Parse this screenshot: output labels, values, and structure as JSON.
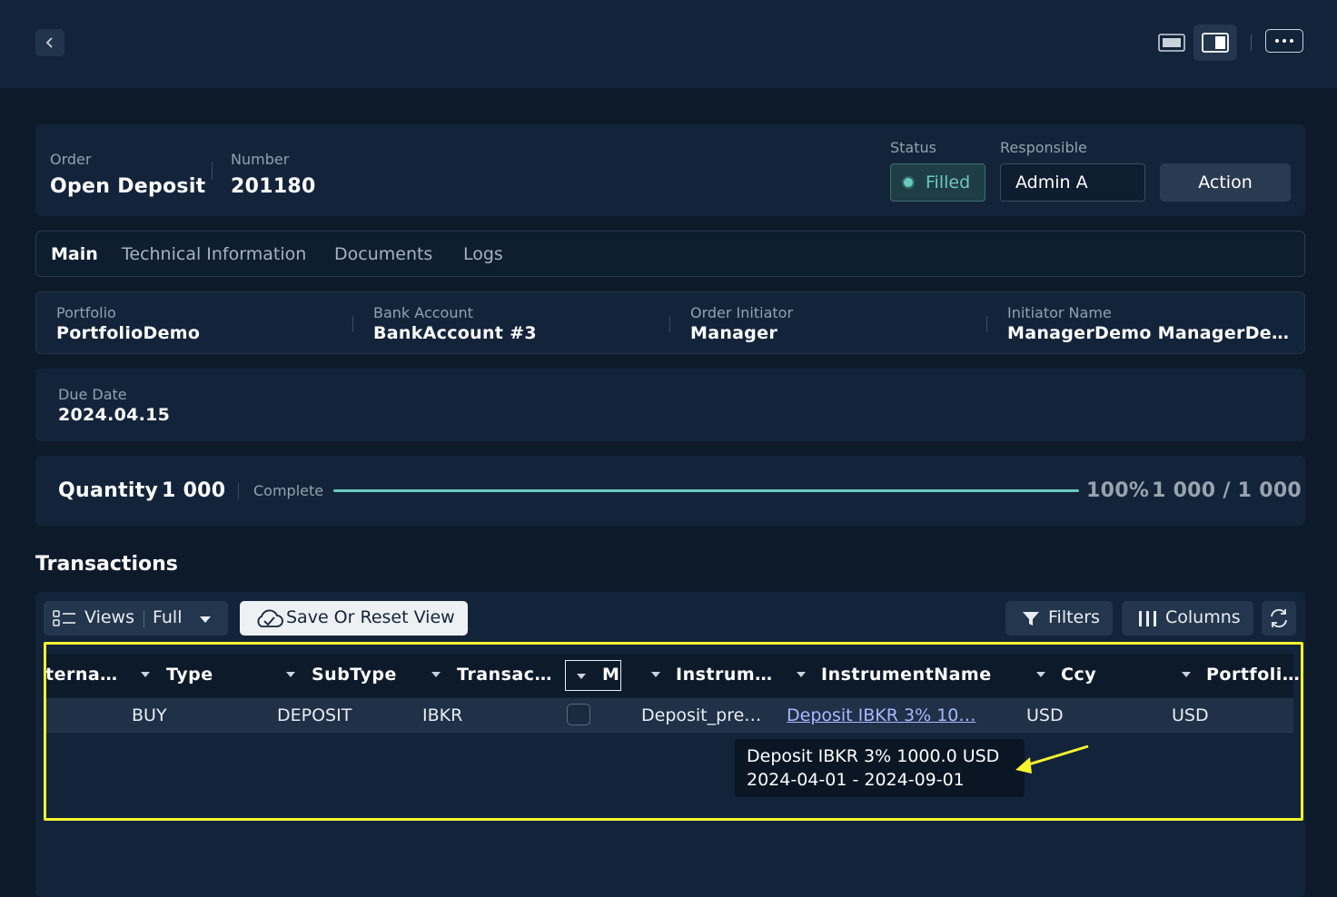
{
  "order": {
    "label": "Order",
    "value": "Open Deposit"
  },
  "number": {
    "label": "Number",
    "value": "201180"
  },
  "status": {
    "label": "Status",
    "value": "Filled",
    "color": "#6cc9bd"
  },
  "responsible": {
    "label": "Responsible",
    "value": "Admin A"
  },
  "action_label": "Action",
  "tabs": [
    {
      "label": "Main",
      "active": true
    },
    {
      "label": "Technical Information"
    },
    {
      "label": "Documents"
    },
    {
      "label": "Logs"
    }
  ],
  "info": [
    {
      "label": "Portfolio",
      "value": "PortfolioDemo"
    },
    {
      "label": "Bank Account",
      "value": "BankAccount #3"
    },
    {
      "label": "Order Initiator",
      "value": "Manager"
    },
    {
      "label": "Initiator Name",
      "value": "ManagerDemo ManagerDe…"
    }
  ],
  "due_date": {
    "label": "Due Date",
    "value": "2024.04.15"
  },
  "quantity": {
    "label": "Quantity",
    "value": "1 000",
    "status": "Complete",
    "percent": "100%",
    "progress_text": "1 000 / 1 000",
    "progress": 1.0
  },
  "transactions": {
    "title": "Transactions",
    "views_label": "Views",
    "view_value": "Full",
    "save_reset_label": "Save Or Reset View",
    "filters_label": "Filters",
    "columns_label": "Columns",
    "headers": [
      "terna…",
      "Type",
      "SubType",
      "Transac…",
      "M",
      "Instrum…",
      "InstrumentName",
      "Ccy",
      "Portfoli…"
    ],
    "rows": [
      {
        "type": "BUY",
        "subtype": "DEPOSIT",
        "transac": "IBKR",
        "instrument": "Deposit_pre…",
        "instrument_name": "Deposit IBKR 3% 10…",
        "ccy": "USD",
        "portfolio": "USD"
      }
    ],
    "tooltip": {
      "line1": "Deposit IBKR 3% 1000.0 USD",
      "line2": "2024-04-01 - 2024-09-01"
    }
  },
  "colors": {
    "accent": "#6cc9bd",
    "highlight": "#f5f530",
    "link": "#a8b8ff"
  }
}
